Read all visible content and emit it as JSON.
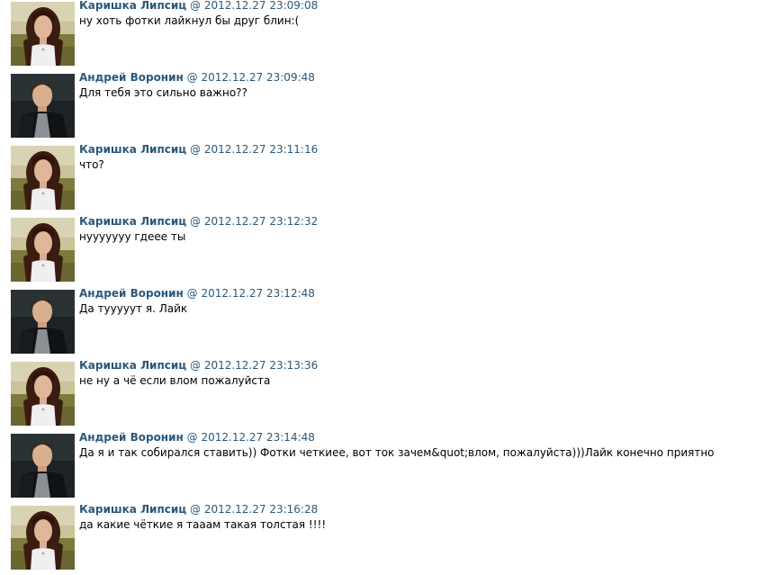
{
  "separator": "@",
  "messages": [
    {
      "author": "Каришка Липсиц",
      "avatar": "female-photo-avatar",
      "timestamp": "2012.12.27 23:09:08",
      "text": "ну хоть фотки лайкнул бы друг блин:("
    },
    {
      "author": "Андрей Воронин",
      "avatar": "male-photo-avatar",
      "timestamp": "2012.12.27 23:09:48",
      "text": "Для тебя это сильно важно??"
    },
    {
      "author": "Каришка Липсиц",
      "avatar": "female-photo-avatar",
      "timestamp": "2012.12.27 23:11:16",
      "text": "что?"
    },
    {
      "author": "Каришка Липсиц",
      "avatar": "female-photo-avatar",
      "timestamp": "2012.12.27 23:12:32",
      "text": "нууууууу гдеее ты"
    },
    {
      "author": "Андрей Воронин",
      "avatar": "male-photo-avatar",
      "timestamp": "2012.12.27 23:12:48",
      "text": "Да тууууут я. Лайк"
    },
    {
      "author": "Каришка Липсиц",
      "avatar": "female-photo-avatar",
      "timestamp": "2012.12.27 23:13:36",
      "text": "не ну а чё если влом пожалуйста"
    },
    {
      "author": "Андрей Воронин",
      "avatar": "male-photo-avatar",
      "timestamp": "2012.12.27 23:14:48",
      "text": "Да я и так собирался ставить)) Фотки четкиее, вот ток зачем&quot;влом, пожалуйста)))Лайк конечно приятно"
    },
    {
      "author": "Каришка Липсиц",
      "avatar": "female-photo-avatar",
      "timestamp": "2012.12.27 23:16:28",
      "text": "да какие чёткие я тааам такая толстая !!!!"
    }
  ],
  "colors": {
    "link": "#2b587a",
    "text": "#000000",
    "background": "#ffffff"
  }
}
